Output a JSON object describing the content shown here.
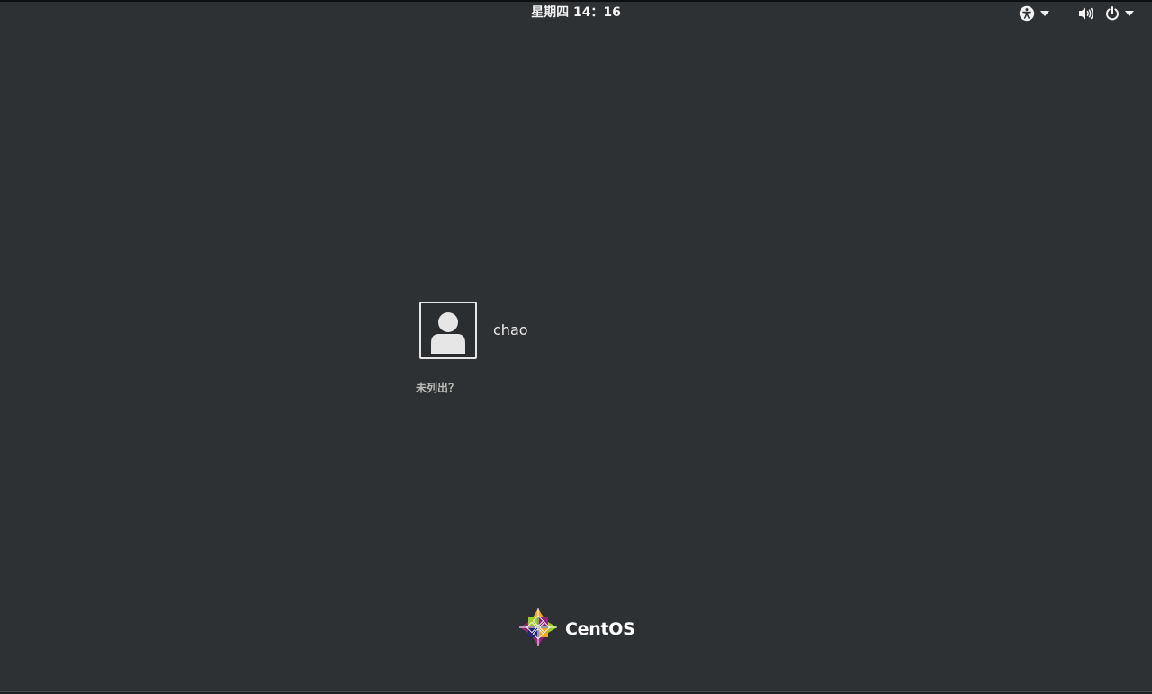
{
  "topbar": {
    "clock": "星期四  14：16",
    "accessibility_icon": "accessibility-icon",
    "volume_icon": "volume-icon",
    "power_icon": "power-icon",
    "menu_arrow_icon": "chevron-down-icon"
  },
  "login": {
    "users": [
      {
        "name": "chao",
        "avatar_icon": "user-avatar-icon"
      }
    ],
    "not_listed": "未列出？"
  },
  "branding": {
    "logo_icon": "centos-logo-icon",
    "name": "CentOS"
  },
  "colors": {
    "background": "#2e3134",
    "text": "#eeeeec",
    "muted_text": "#babdb6",
    "logo_yellow": "#efa724",
    "logo_green": "#9ccd2a",
    "logo_purple": "#932279",
    "logo_blue": "#262577"
  }
}
